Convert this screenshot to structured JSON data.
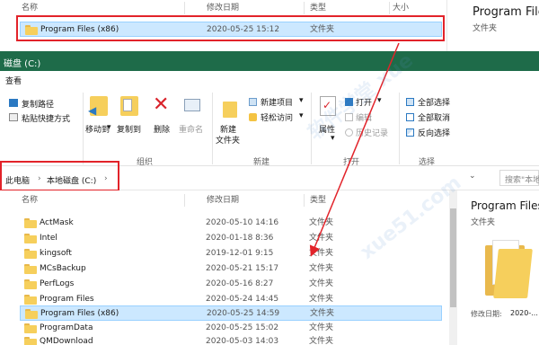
{
  "top_window": {
    "columns": {
      "name": "名称",
      "date": "修改日期",
      "type": "类型",
      "size": "大小"
    },
    "selected_row": {
      "name": "Program Files (x86)",
      "date": "2020-05-25 15:12",
      "type": "文件夹"
    },
    "preview": {
      "title": "Program File",
      "subtitle": "文件夹"
    }
  },
  "window": {
    "title": "磁盘 (C:)",
    "tabs": {
      "view": "查看"
    }
  },
  "ribbon": {
    "copy_path": "复制路径",
    "paste_shortcut": "粘贴快捷方式",
    "move_to": "移动到",
    "copy_to": "复制到",
    "delete": "删除",
    "rename": "重命名",
    "new_folder_line1": "新建",
    "new_folder_line2": "文件夹",
    "new_item": "新建项目",
    "easy_access": "轻松访问",
    "properties": "属性",
    "open": "打开",
    "edit": "编辑",
    "history": "历史记录",
    "select_all": "全部选择",
    "select_none": "全部取消",
    "invert_selection": "反向选择",
    "groups": {
      "organize": "组织",
      "new": "新建",
      "open": "打开",
      "select": "选择"
    }
  },
  "address": {
    "crumbs": [
      "此电脑",
      "本地磁盘 (C:)"
    ],
    "search_placeholder": "搜索\"本地..."
  },
  "list": {
    "columns": {
      "name": "名称",
      "date": "修改日期",
      "type": "类型"
    },
    "rows": [
      {
        "name": "ActMask",
        "date": "2020-05-10 14:16",
        "type": "文件夹"
      },
      {
        "name": "Intel",
        "date": "2020-01-18 8:36",
        "type": "文件夹"
      },
      {
        "name": "kingsoft",
        "date": "2019-12-01 9:15",
        "type": "文件夹"
      },
      {
        "name": "MCsBackup",
        "date": "2020-05-21 15:17",
        "type": "文件夹"
      },
      {
        "name": "PerfLogs",
        "date": "2020-05-16 8:27",
        "type": "文件夹"
      },
      {
        "name": "Program Files",
        "date": "2020-05-24 14:45",
        "type": "文件夹"
      },
      {
        "name": "Program Files (x86)",
        "date": "2020-05-25 14:59",
        "type": "文件夹"
      },
      {
        "name": "ProgramData",
        "date": "2020-05-25 15:02",
        "type": "文件夹"
      },
      {
        "name": "QMDownload",
        "date": "2020-05-03 14:03",
        "type": "文件夹"
      }
    ]
  },
  "preview": {
    "title": "Program Files",
    "subtitle": "文件夹",
    "modified_label": "修改日期:",
    "modified_value": "2020-..."
  },
  "colors": {
    "title_bar": "#1e6b49",
    "selection": "#cce8ff",
    "annotation": "#e2232a"
  }
}
